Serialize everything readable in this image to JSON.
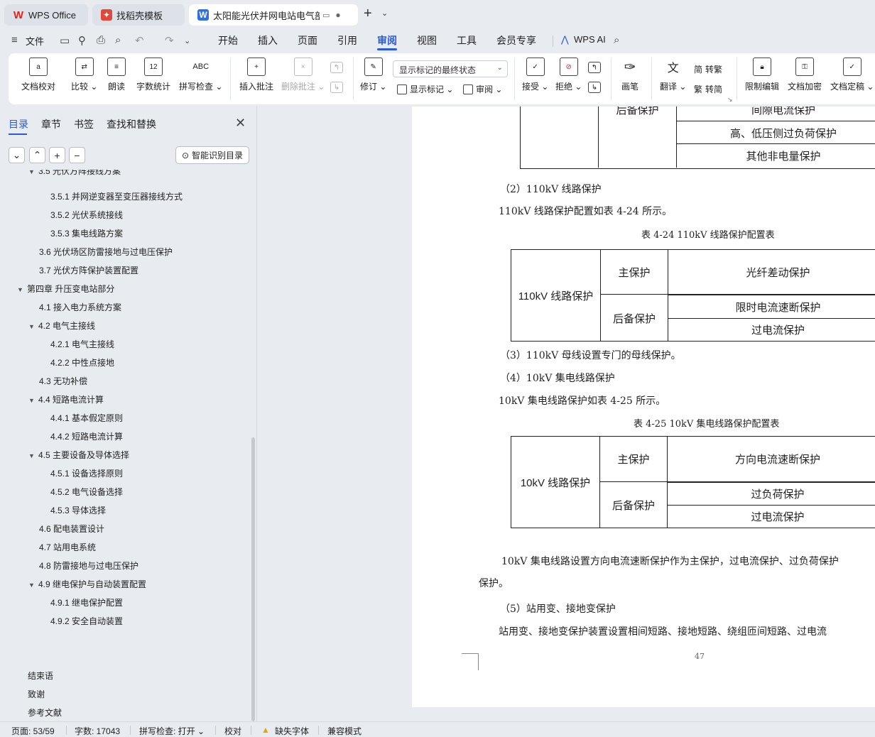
{
  "tabs": [
    {
      "label": "WPS Office",
      "icon": "wps-logo-icon"
    },
    {
      "label": "找稻壳模板",
      "icon": "docer-icon"
    },
    {
      "label": "太阳能光伏并网电站电气部分",
      "icon": "writer-doc-icon",
      "active": true
    }
  ],
  "menu": {
    "file": "文件",
    "items": [
      "开始",
      "插入",
      "页面",
      "引用",
      "审阅",
      "视图",
      "工具",
      "会员专享"
    ],
    "active": "审阅",
    "ai": "WPS AI"
  },
  "ribbon": {
    "doc_check": "文档校对",
    "compare": "比较",
    "read_aloud": "朗读",
    "word_count": "字数统计",
    "spell_check": "拼写检查",
    "insert_comment": "插入批注",
    "delete_comment": "删除批注",
    "revise": "修订",
    "markup_state": "显示标记的最终状态",
    "show_markup": "显示标记",
    "review": "审阅",
    "accept": "接受",
    "reject": "拒绝",
    "pen": "画笔",
    "translate": "翻译",
    "to_traditional": "转繁",
    "to_simplified": "转简",
    "restrict_edit": "限制编辑",
    "encrypt": "文档加密",
    "finalize": "文档定稿"
  },
  "panel": {
    "tabs": [
      "目录",
      "章节",
      "书签",
      "查找和替换"
    ],
    "active_tab": "目录",
    "smart_toc": "智能识别目录",
    "toc": [
      {
        "text": "3.5  光伏方阵接线方案",
        "level": 1,
        "arrow": true
      },
      {
        "text": "3.5.1  并网逆变器至变压器接线方式",
        "level": 2
      },
      {
        "text": "3.5.2  光伏系统接线",
        "level": 2
      },
      {
        "text": "3.5.3  集电线路方案",
        "level": 2
      },
      {
        "text": "3.6  光伏场区防雷接地与过电压保护",
        "level": 1
      },
      {
        "text": "3.7  光伏方阵保护装置配置",
        "level": 1
      },
      {
        "text": "第四章  升压变电站部分",
        "level": 0,
        "arrow": true
      },
      {
        "text": "4.1  接入电力系统方案",
        "level": 1
      },
      {
        "text": "4.2  电气主接线",
        "level": 1,
        "arrow": true
      },
      {
        "text": "4.2.1  电气主接线",
        "level": 2
      },
      {
        "text": "4.2.2  中性点接地",
        "level": 2
      },
      {
        "text": "4.3  无功补偿",
        "level": 1
      },
      {
        "text": "4.4  短路电流计算",
        "level": 1,
        "arrow": true
      },
      {
        "text": "4.4.1 基本假定原则",
        "level": 2
      },
      {
        "text": "4.4.2  短路电流计算",
        "level": 2
      },
      {
        "text": "4.5  主要设备及导体选择",
        "level": 1,
        "arrow": true
      },
      {
        "text": "4.5.1  设备选择原则",
        "level": 2
      },
      {
        "text": "4.5.2  电气设备选择",
        "level": 2
      },
      {
        "text": "4.5.3  导体选择",
        "level": 2
      },
      {
        "text": "4.6  配电装置设计",
        "level": 1
      },
      {
        "text": "4.7  站用电系统",
        "level": 1
      },
      {
        "text": "4.8  防雷接地与过电压保护",
        "level": 1
      },
      {
        "text": "4.9  继电保护与自动装置配置",
        "level": 1,
        "arrow": true
      },
      {
        "text": "4.9.1  继电保护配置",
        "level": 2
      },
      {
        "text": "4.9.2  安全自动装置",
        "level": 2
      }
    ],
    "toc_tail": [
      "结束语",
      "致谢",
      "参考文献"
    ]
  },
  "doc": {
    "top_table": {
      "backup": "后备保护",
      "rows": [
        "间隙电流保护",
        "高、低压侧过负荷保护",
        "其他非电量保护"
      ]
    },
    "p1": "（2）110kV 线路保护",
    "p2": "110kV 线路保护配置如表 4-24 所示。",
    "cap1": "表 4-24  110kV 线路保护配置表",
    "t1": {
      "name": "110kV 线路保护",
      "main": "主保护",
      "main_val": "光纤差动保护",
      "backup": "后备保护",
      "backup_vals": [
        "限时电流速断保护",
        "过电流保护"
      ]
    },
    "p3": "（3）110kV 母线设置专门的母线保护。",
    "p4": "（4）10kV 集电线路保护",
    "p5": "10kV 集电线路保护如表 4-25 所示。",
    "cap2": "表 4-25  10kV 集电线路保护配置表",
    "t2": {
      "name": "10kV 线路保护",
      "main": "主保护",
      "main_val": "方向电流速断保护",
      "backup": "后备保护",
      "backup_vals": [
        "过负荷保护",
        "过电流保护"
      ]
    },
    "p6": "10kV 集电线路设置方向电流速断保护作为主保护，过电流保护、过负荷保护",
    "p7": "保护。",
    "p8": "（5）站用变、接地变保护",
    "p9": "站用变、接地变保护装置设置相间短路、接地短路、绕组匝间短路、过电流",
    "page_number": "47"
  },
  "status": {
    "page": "页面: 53/59",
    "words": "字数: 17043",
    "spell": "拼写检查: 打开",
    "proof": "校对",
    "missing_font": "缺失字体",
    "compat": "兼容模式"
  },
  "colors": {
    "accent": "#2a5bd7",
    "wps_red": "#e2231a",
    "docer": "#e0483a",
    "writer_blue": "#2f6fe4"
  }
}
